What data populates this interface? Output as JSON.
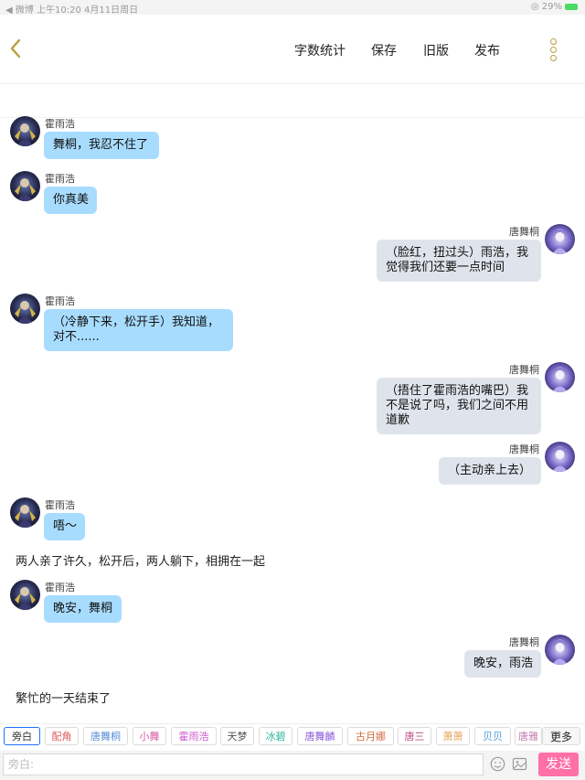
{
  "status_bar": {
    "left_text": "◀ 微博  上午10:20  4月11日周日",
    "right_text": "◎ 29%"
  },
  "header": {
    "actions": [
      "字数统计",
      "保存",
      "旧版",
      "发布"
    ]
  },
  "messages": [
    {
      "type": "left",
      "name": "霍雨浩",
      "lines": [
        "舞桐，我忍不住了"
      ]
    },
    {
      "type": "left",
      "name": "霍雨浩",
      "lines": [
        "你真美"
      ]
    },
    {
      "type": "right",
      "name": "唐舞桐",
      "lines": [
        "（脸红，扭过头）雨浩，我",
        "觉得我们还要一点时间"
      ]
    },
    {
      "type": "left",
      "name": "霍雨浩",
      "lines": [
        "（冷静下来，松开手）我知道，",
        "对不......"
      ]
    },
    {
      "type": "right",
      "name": "唐舞桐",
      "lines": [
        "（捂住了霍雨浩的嘴巴）我",
        "不是说了吗，我们之间不用",
        "道歉"
      ]
    },
    {
      "type": "right",
      "name": "唐舞桐",
      "lines": [
        "（主动亲上去）"
      ]
    },
    {
      "type": "left",
      "name": "霍雨浩",
      "lines": [
        "唔～"
      ]
    },
    {
      "type": "narration",
      "text": "两人亲了许久，松开后，两人躺下，相拥在一起"
    },
    {
      "type": "left",
      "name": "霍雨浩",
      "lines": [
        "晚安，舞桐"
      ]
    },
    {
      "type": "right",
      "name": "唐舞桐",
      "lines": [
        "晚安，雨浩"
      ]
    },
    {
      "type": "narration",
      "text": "繁忙的一天结束了"
    }
  ],
  "role_chips": [
    {
      "label": "旁白",
      "color": "#333333",
      "active": true
    },
    {
      "label": "配角",
      "color": "#e05a5a"
    },
    {
      "label": "唐舞桐",
      "color": "#5a8fd6"
    },
    {
      "label": "小舞",
      "color": "#d85aa8"
    },
    {
      "label": "霍雨浩",
      "color": "#d05ad0"
    },
    {
      "label": "天梦",
      "color": "#555555"
    },
    {
      "label": "冰碧",
      "color": "#2fb5a0"
    },
    {
      "label": "唐舞麟",
      "color": "#8b5ad8"
    },
    {
      "label": "古月娜",
      "color": "#d06a3a"
    },
    {
      "label": "唐三",
      "color": "#c0508a"
    },
    {
      "label": "萧萧",
      "color": "#e8a050"
    },
    {
      "label": "贝贝",
      "color": "#50a0d8"
    },
    {
      "label": "唐雅",
      "color": "#c07ab0"
    }
  ],
  "more_label": "更多",
  "input": {
    "placeholder": "旁白:"
  },
  "send_label": "发送",
  "colors": {
    "left_bubble": "#a8dcff",
    "right_bubble": "#dfe4ec",
    "send": "#ff6fa8",
    "accent_gold": "#b8a040"
  }
}
